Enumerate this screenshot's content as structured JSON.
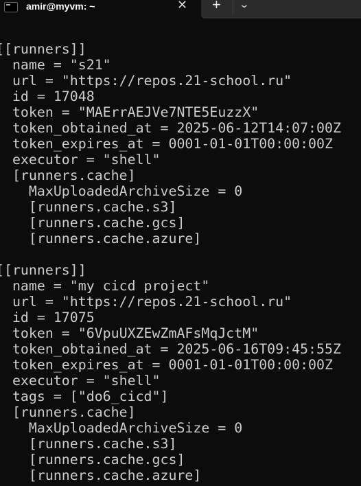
{
  "window": {
    "tab_title": "amir@myvm: ~",
    "close_label": "✕",
    "new_tab_label": "+",
    "dropdown_label": "⌄"
  },
  "terminal": {
    "lines": [
      "",
      "[[runners]]",
      "  name = \"s21\"",
      "  url = \"https://repos.21-school.ru\"",
      "  id = 17048",
      "  token = \"MAErrAEJVe7NTE5EuzzX\"",
      "  token_obtained_at = 2025-06-12T14:07:00Z",
      "  token_expires_at = 0001-01-01T00:00:00Z",
      "  executor = \"shell\"",
      "  [runners.cache]",
      "    MaxUploadedArchiveSize = 0",
      "    [runners.cache.s3]",
      "    [runners.cache.gcs]",
      "    [runners.cache.azure]",
      "",
      "[[runners]]",
      "  name = \"my cicd project\"",
      "  url = \"https://repos.21-school.ru\"",
      "  id = 17075",
      "  token = \"6VpuUXZEwZmAFsMqJctM\"",
      "  token_obtained_at = 2025-06-16T09:45:55Z",
      "  token_expires_at = 0001-01-01T00:00:00Z",
      "  executor = \"shell\"",
      "  tags = [\"do6_cicd\"]",
      "  [runners.cache]",
      "    MaxUploadedArchiveSize = 0",
      "    [runners.cache.s3]",
      "    [runners.cache.gcs]",
      "    [runners.cache.azure]"
    ]
  }
}
